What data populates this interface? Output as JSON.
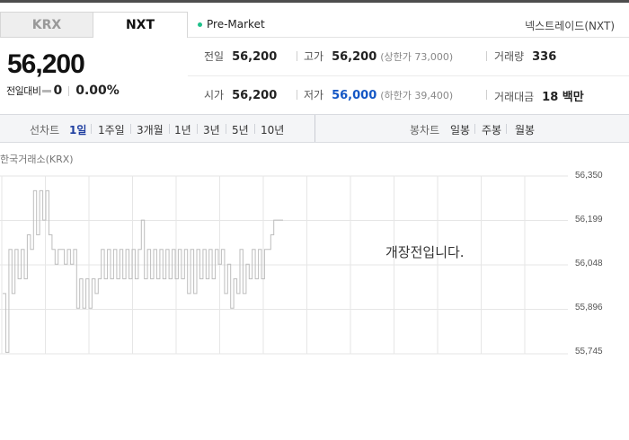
{
  "market_tabs": [
    {
      "label": "KRX",
      "active": false
    },
    {
      "label": "NXT",
      "active": true
    }
  ],
  "session_status": "Pre-Market",
  "exchange_name": "넥스트레이드(NXT)",
  "price": "56,200",
  "change": {
    "label": "전일대비",
    "value": "0",
    "percent": "0.00%"
  },
  "stats": {
    "prev_close": {
      "label": "전일",
      "value": "56,200"
    },
    "high": {
      "label": "고가",
      "value": "56,200",
      "sub": "(상한가 73,000)"
    },
    "volume": {
      "label": "거래량",
      "value": "336"
    },
    "open": {
      "label": "시가",
      "value": "56,200"
    },
    "low": {
      "label": "저가",
      "value": "56,000",
      "sub": "(하한가 39,400)"
    },
    "amount": {
      "label": "거래대금",
      "value": "18 백만"
    }
  },
  "period_bar": {
    "line_label": "선차트",
    "line_periods": [
      "1일",
      "1주일",
      "3개월",
      "1년",
      "3년",
      "5년",
      "10년"
    ],
    "active_period": "1일",
    "candle_label": "봉차트",
    "candle_periods": [
      "일봉",
      "주봉",
      "월봉"
    ]
  },
  "chart": {
    "source_label": "한국거래소(KRX)",
    "message": "개장전입니다.",
    "line_color": "#bdbdbd",
    "grid_color": "#e6e6e6"
  },
  "chart_data": {
    "type": "line",
    "title": "",
    "y_ticks": [
      "56,350",
      "56,199",
      "56,048",
      "55,896",
      "55,745"
    ],
    "ylim": [
      55745,
      56350
    ],
    "grid": true,
    "series": [
      {
        "values": [
          55950,
          55750,
          56100,
          55950,
          56100,
          56000,
          56100,
          56000,
          56150,
          56100,
          56300,
          56150,
          56300,
          56200,
          56300,
          56150,
          56100,
          56050,
          56100,
          56100,
          56050,
          56100,
          56050,
          56100,
          55900,
          56000,
          55900,
          56000,
          55900,
          56000,
          55950,
          56000,
          56100,
          56000,
          56100,
          56000,
          56100,
          56000,
          56100,
          56000,
          56100,
          56000,
          56100,
          56000,
          56100,
          56200,
          56000,
          56100,
          56000,
          56100,
          56000,
          56100,
          56000,
          56100,
          56000,
          56100,
          56000,
          56100,
          56000,
          56100,
          55950,
          56100,
          55950,
          56100,
          56000,
          56100,
          56000,
          56100,
          56000,
          56100,
          56050,
          56100,
          55950,
          56050,
          55900,
          56000,
          55950,
          56100,
          55950,
          56050,
          56000,
          56100,
          56000,
          56100,
          56000,
          56100,
          56100,
          56150,
          56200,
          56200,
          56200,
          56200
        ]
      }
    ]
  }
}
